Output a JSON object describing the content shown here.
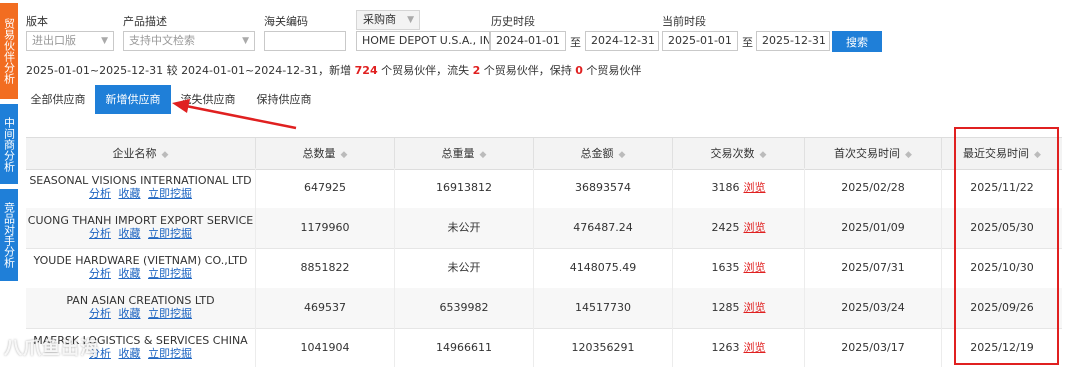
{
  "side_tabs": [
    "贸易伙伴分析",
    "中间商分析",
    "竞品对手分析"
  ],
  "filters": {
    "labels": {
      "edition": "版本",
      "product": "产品描述",
      "hs_code": "海关编码",
      "history": "历史时段",
      "current": "当前时段"
    },
    "edition_value": "进出口版",
    "product_placeholder": "支持中文检索",
    "hs_code_value": "",
    "vendor_select": "采购商",
    "vendor_value": "HOME DEPOT U.S.A., INC",
    "history_from": "2024-01-01",
    "history_to": "2024-12-31",
    "current_from": "2025-01-01",
    "current_to": "2025-12-31",
    "range_sep": "至",
    "search_label": "搜索"
  },
  "summary": {
    "prefix": "2025-01-01~2025-12-31 较 2024-01-01~2024-12-31，新增",
    "new_count": "724",
    "mid1": "个贸易伙伴，流失",
    "lost_count": "2",
    "mid2": "个贸易伙伴，保持",
    "kept_count": "0",
    "suffix": "个贸易伙伴"
  },
  "tabs": [
    "全部供应商",
    "新增供应商",
    "流失供应商",
    "保持供应商"
  ],
  "table": {
    "headers": [
      "企业名称",
      "总数量",
      "总重量",
      "总金额",
      "交易次数",
      "首次交易时间",
      "最近交易时间"
    ],
    "actions": [
      "分析",
      "收藏",
      "立即挖掘"
    ],
    "browse_label": "浏览",
    "rows": [
      {
        "name": "SEASONAL VISIONS INTERNATIONAL LTD",
        "qty": "647925",
        "weight": "16913812",
        "amount": "36893574",
        "count": "3186",
        "first": "2025/02/28",
        "last": "2025/11/22"
      },
      {
        "name": "CUONG THANH IMPORT EXPORT SERVICE",
        "qty": "1179960",
        "weight": "未公开",
        "amount": "476487.24",
        "count": "2425",
        "first": "2025/01/09",
        "last": "2025/05/30"
      },
      {
        "name": "YOUDE HARDWARE (VIETNAM) CO.,LTD",
        "qty": "8851822",
        "weight": "未公开",
        "amount": "4148075.49",
        "count": "1635",
        "first": "2025/07/31",
        "last": "2025/10/30"
      },
      {
        "name": "PAN ASIAN CREATIONS LTD",
        "qty": "469537",
        "weight": "6539982",
        "amount": "14517730",
        "count": "1285",
        "first": "2025/03/24",
        "last": "2025/09/26"
      },
      {
        "name": "MAERSK LOGISTICS & SERVICES CHINA",
        "qty": "1041904",
        "weight": "14966611",
        "amount": "120356291",
        "count": "1263",
        "first": "2025/03/17",
        "last": "2025/12/19"
      }
    ]
  },
  "watermark": "八爪鱼出海",
  "colors": {
    "accent": "#1f7fd8",
    "orange": "#f26d21",
    "highlight": "#e02020"
  }
}
